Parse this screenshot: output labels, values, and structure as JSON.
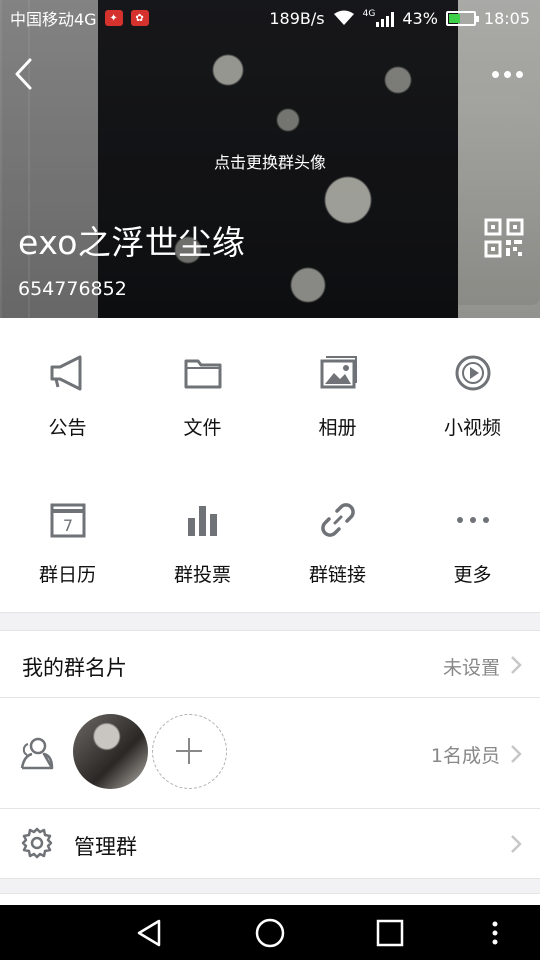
{
  "status_bar": {
    "carrier": "中国移动4G",
    "network_speed": "189B/s",
    "network_type": "4G",
    "battery_level": "43%",
    "time": "18:05"
  },
  "header": {
    "change_avatar_hint": "点击更换群头像",
    "group_name": "exo之浮世尘缘",
    "group_id": "654776852"
  },
  "features": [
    {
      "label": "公告",
      "icon": "megaphone-icon"
    },
    {
      "label": "文件",
      "icon": "folder-icon"
    },
    {
      "label": "相册",
      "icon": "album-icon"
    },
    {
      "label": "小视频",
      "icon": "video-icon"
    },
    {
      "label": "群日历",
      "icon": "calendar-icon"
    },
    {
      "label": "群投票",
      "icon": "poll-icon"
    },
    {
      "label": "群链接",
      "icon": "link-icon"
    },
    {
      "label": "更多",
      "icon": "more-icon"
    }
  ],
  "calendar_day": "7",
  "group_card": {
    "title": "我的群名片",
    "value": "未设置"
  },
  "members": {
    "count_label": "1名成员"
  },
  "manage": {
    "title": "管理群"
  },
  "colors": {
    "icon_gray": "#6f7276",
    "chevron": "#c7c7c7",
    "battery_green": "#3fd14a"
  }
}
